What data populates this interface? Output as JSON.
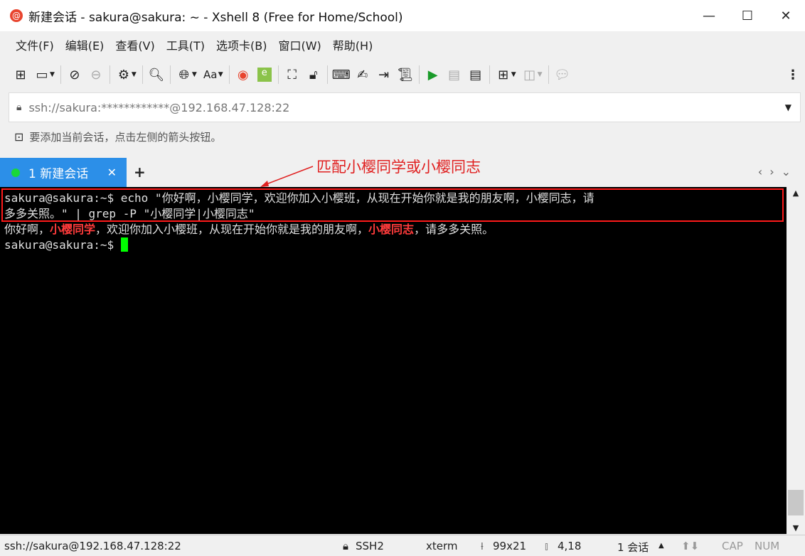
{
  "window": {
    "title": "新建会话 - sakura@sakura: ~ - Xshell 8 (Free for Home/School)"
  },
  "menu": [
    "文件(F)",
    "编辑(E)",
    "查看(V)",
    "工具(T)",
    "选项卡(B)",
    "窗口(W)",
    "帮助(H)"
  ],
  "address": {
    "value": "ssh://sakura:************@192.168.47.128:22"
  },
  "hint": "要添加当前会话，点击左侧的箭头按钮。",
  "tabs": [
    {
      "label": "1 新建会话",
      "status_color": "#19d83a",
      "active": true
    }
  ],
  "annotation": "匹配小樱同学或小樱同志",
  "terminal": {
    "prompt": "sakura@sakura:~$ ",
    "command_line1": "echo \"你好啊，小樱同学，欢迎你加入小樱班，从现在开始你就是我的朋友啊，小樱同志，请",
    "command_line2": "多多关照。\" | grep -P \"小樱同学|小樱同志\"",
    "output": [
      "你好啊，",
      "小樱同学",
      "，欢迎你加入小樱班，从现在开始你就是我的朋友啊，",
      "小樱同志",
      "，请多多关照。"
    ],
    "match_color": "#ff3b3b"
  },
  "status": {
    "connection": "ssh://sakura@192.168.47.128:22",
    "protocol": "SSH2",
    "term": "xterm",
    "size": "99x21",
    "cursor": "4,18",
    "sessions": "1 会话",
    "cap": "CAP",
    "num": "NUM"
  }
}
